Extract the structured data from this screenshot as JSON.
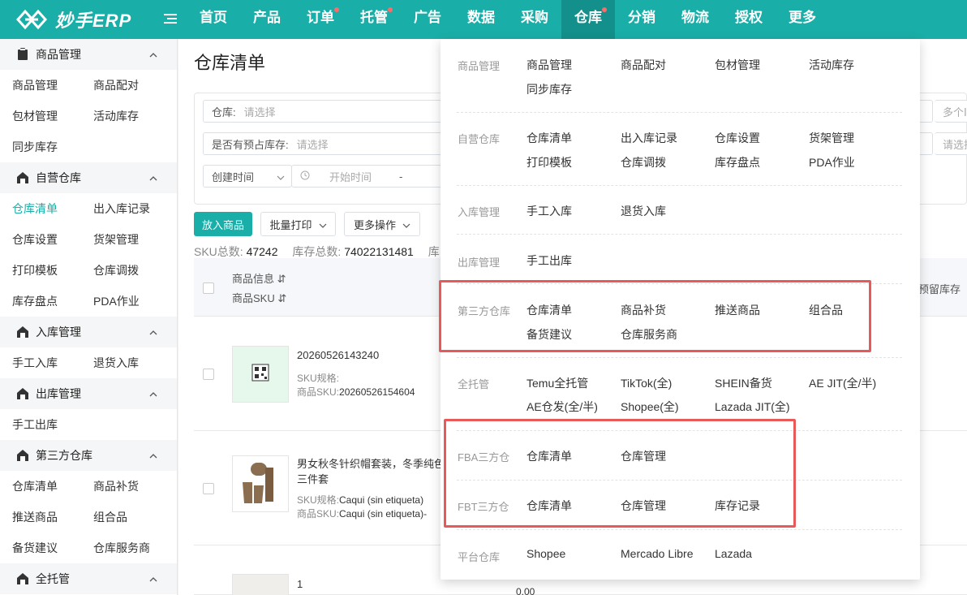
{
  "app": {
    "logo_text": "妙手ERP",
    "nav": [
      {
        "label": "首页",
        "dot": false,
        "active": false
      },
      {
        "label": "产品",
        "dot": false,
        "active": false
      },
      {
        "label": "订单",
        "dot": true,
        "active": false
      },
      {
        "label": "托管",
        "dot": true,
        "active": false
      },
      {
        "label": "广告",
        "dot": false,
        "active": false
      },
      {
        "label": "数据",
        "dot": false,
        "active": false
      },
      {
        "label": "采购",
        "dot": false,
        "active": false
      },
      {
        "label": "仓库",
        "dot": true,
        "active": true
      },
      {
        "label": "分销",
        "dot": false,
        "active": false
      },
      {
        "label": "物流",
        "dot": false,
        "active": false
      },
      {
        "label": "授权",
        "dot": false,
        "active": false
      },
      {
        "label": "更多",
        "dot": false,
        "active": false
      }
    ],
    "accent_color": "#1aaea8",
    "highlight_color": "#e85a5a"
  },
  "sidebar": {
    "groups": [
      {
        "title": "商品管理",
        "items": [
          "商品管理",
          "商品配对",
          "包材管理",
          "活动库存",
          "同步库存"
        ]
      },
      {
        "title": "自营仓库",
        "items": [
          "仓库清单",
          "出入库记录",
          "仓库设置",
          "货架管理",
          "打印模板",
          "仓库调拨",
          "库存盘点",
          "PDA作业"
        ]
      },
      {
        "title": "入库管理",
        "items": [
          "手工入库",
          "退货入库"
        ]
      },
      {
        "title": "出库管理",
        "items": [
          "手工出库"
        ]
      },
      {
        "title": "第三方仓库",
        "items": [
          "仓库清单",
          "商品补货",
          "推送商品",
          "组合品",
          "备货建议",
          "仓库服务商"
        ]
      },
      {
        "title": "全托管",
        "items": []
      }
    ],
    "active_item": "仓库清单"
  },
  "main": {
    "title": "仓库清单",
    "filters": {
      "warehouse_label": "仓库:",
      "warehouse_placeholder": "请选择",
      "preoccupy_label": "是否有预占库存:",
      "preoccupy_placeholder": "请选择",
      "time_type": "创建时间",
      "start_placeholder": "开始时间",
      "range_sep": "-",
      "right_field_1": "多个Ⅰ",
      "right_field_2": "请选择"
    },
    "buttons": {
      "add": "放入商品",
      "batch_print": "批量打印",
      "more": "更多操作"
    },
    "stats": {
      "sku_label": "SKU总数:",
      "sku_value": "47242",
      "stock_label": "库存总数:",
      "stock_value": "74022131481",
      "extra_label": "库"
    },
    "table": {
      "header_info": "商品信息",
      "header_sku": "商品SKU",
      "header_right": "动预留库存",
      "rows": [
        {
          "title": "20260526143240",
          "spec_label": "SKU规格:",
          "spec_value": "",
          "sku_label": "商品SKU:",
          "sku_value": "20260526154604"
        },
        {
          "title": "男女秋冬针织帽套装，冬季纯色",
          "title2": "三件套",
          "spec_label": "SKU规格:",
          "spec_value": "Caqui (sin etiqueta)",
          "sku_label": "商品SKU:",
          "sku_value": "Caqui (sin etiqueta)-"
        },
        {
          "title": "1",
          "extra": "0.00"
        }
      ]
    }
  },
  "dropdown": {
    "sections": [
      {
        "label": "商品管理",
        "items": [
          "商品管理",
          "商品配对",
          "包材管理",
          "活动库存",
          "同步库存"
        ]
      },
      {
        "label": "自营仓库",
        "items": [
          "仓库清单",
          "出入库记录",
          "仓库设置",
          "货架管理",
          "打印模板",
          "仓库调拨",
          "库存盘点",
          "PDA作业"
        ]
      },
      {
        "label": "入库管理",
        "items": [
          "手工入库",
          "退货入库"
        ]
      },
      {
        "label": "出库管理",
        "items": [
          "手工出库"
        ]
      },
      {
        "label": "第三方仓库",
        "items": [
          "仓库清单",
          "商品补货",
          "推送商品",
          "组合品",
          "备货建议",
          "仓库服务商"
        ]
      },
      {
        "label": "全托管",
        "items": [
          "Temu全托管",
          "TikTok(全)",
          "SHEIN备货",
          "AE JIT(全/半)",
          "AE仓发(全/半)",
          "Shopee(全)",
          "Lazada JIT(全)"
        ]
      },
      {
        "label": "FBA三方仓",
        "items": [
          "仓库清单",
          "仓库管理"
        ]
      },
      {
        "label": "FBT三方仓",
        "items": [
          "仓库清单",
          "仓库管理",
          "库存记录"
        ]
      },
      {
        "label": "平台仓库",
        "items": [
          "Shopee",
          "Mercado Libre",
          "Lazada"
        ]
      }
    ]
  }
}
